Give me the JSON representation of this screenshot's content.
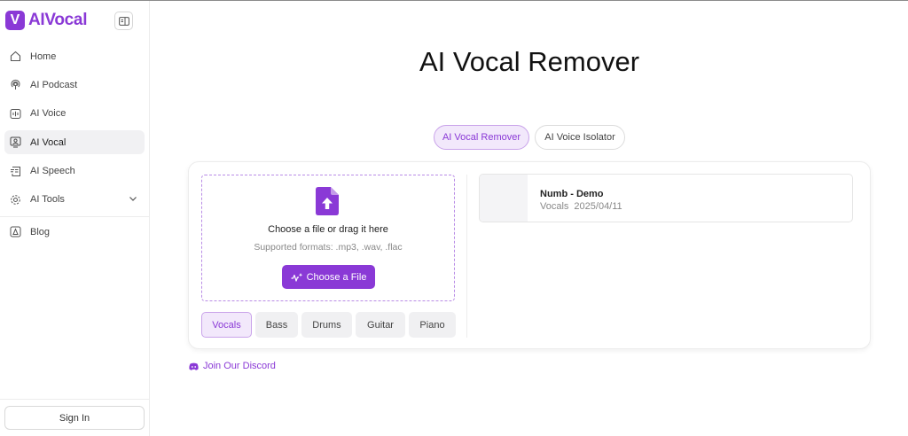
{
  "brand": {
    "logo_letter": "V",
    "name": "AIVocal",
    "color": "#8a39d6"
  },
  "sidebar": {
    "items": [
      {
        "label": "Home",
        "icon": "home-icon"
      },
      {
        "label": "AI Podcast",
        "icon": "podcast-icon"
      },
      {
        "label": "AI Voice",
        "icon": "voice-icon"
      },
      {
        "label": "AI Vocal",
        "icon": "vocal-icon",
        "active": true
      },
      {
        "label": "AI Speech",
        "icon": "speech-icon"
      },
      {
        "label": "AI Tools",
        "icon": "tools-icon",
        "expandable": true
      }
    ],
    "blog": {
      "label": "Blog",
      "icon": "blog-icon"
    },
    "signin_label": "Sign In"
  },
  "main": {
    "title": "AI Vocal Remover",
    "tabs": [
      {
        "label": "AI Vocal Remover",
        "active": true
      },
      {
        "label": "AI Voice Isolator",
        "active": false
      }
    ],
    "upload": {
      "prompt": "Choose a file or drag it here",
      "formats": "Supported formats: .mp3, .wav, .flac",
      "button_label": "Choose a File"
    },
    "stems": [
      {
        "label": "Vocals",
        "active": true
      },
      {
        "label": "Bass",
        "active": false
      },
      {
        "label": "Drums",
        "active": false
      },
      {
        "label": "Guitar",
        "active": false
      },
      {
        "label": "Piano",
        "active": false
      }
    ],
    "track": {
      "name": "Numb - Demo",
      "type": "Vocals",
      "date": "2025/04/11"
    },
    "discord_label": "Join Our Discord"
  }
}
